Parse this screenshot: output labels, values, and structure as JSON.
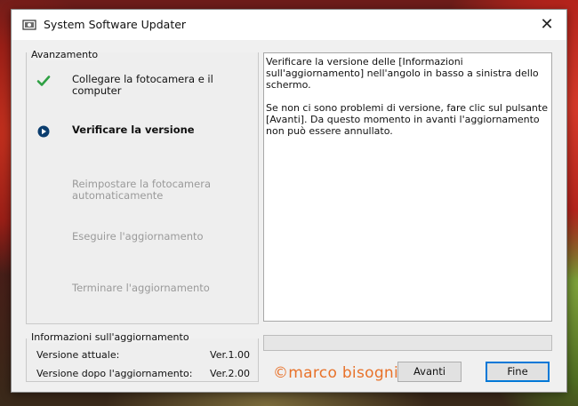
{
  "window": {
    "title": "System Software Updater",
    "close_glyph": "✕"
  },
  "progress_group": {
    "label": "Avanzamento",
    "steps": [
      {
        "label": "Collegare la fotocamera e il computer",
        "state": "done",
        "icon": "checkmark-icon"
      },
      {
        "label": "Verificare la versione",
        "state": "current",
        "icon": "current-step-icon"
      },
      {
        "label": "Reimpostare la fotocamera automaticamente",
        "state": "pending",
        "icon": ""
      },
      {
        "label": "Eseguire l'aggiornamento",
        "state": "pending",
        "icon": ""
      },
      {
        "label": "Terminare l'aggiornamento",
        "state": "pending",
        "icon": ""
      }
    ]
  },
  "message": {
    "paragraph1": "Verificare la versione delle [Informazioni sull'aggiornamento] nell'angolo in basso a sinistra dello schermo.",
    "paragraph2": "Se non ci sono problemi di versione, fare clic sul pulsante [Avanti]. Da questo momento in avanti l'aggiornamento non può essere annullato."
  },
  "update_info": {
    "label": "Informazioni sull'aggiornamento",
    "current_label": "Versione attuale:",
    "current_value": "Ver.1.00",
    "after_label": "Versione dopo l'aggiornamento:",
    "after_value": "Ver.2.00"
  },
  "progress_bar": {
    "value": 0
  },
  "watermark": "©marco bisogni",
  "buttons": {
    "next_label": "Avanti",
    "finish_label": "Fine"
  },
  "colors": {
    "check_green": "#2ea043",
    "current_blue": "#0b3d6e",
    "default_button_border": "#0078d7",
    "watermark": "#e8722a"
  }
}
